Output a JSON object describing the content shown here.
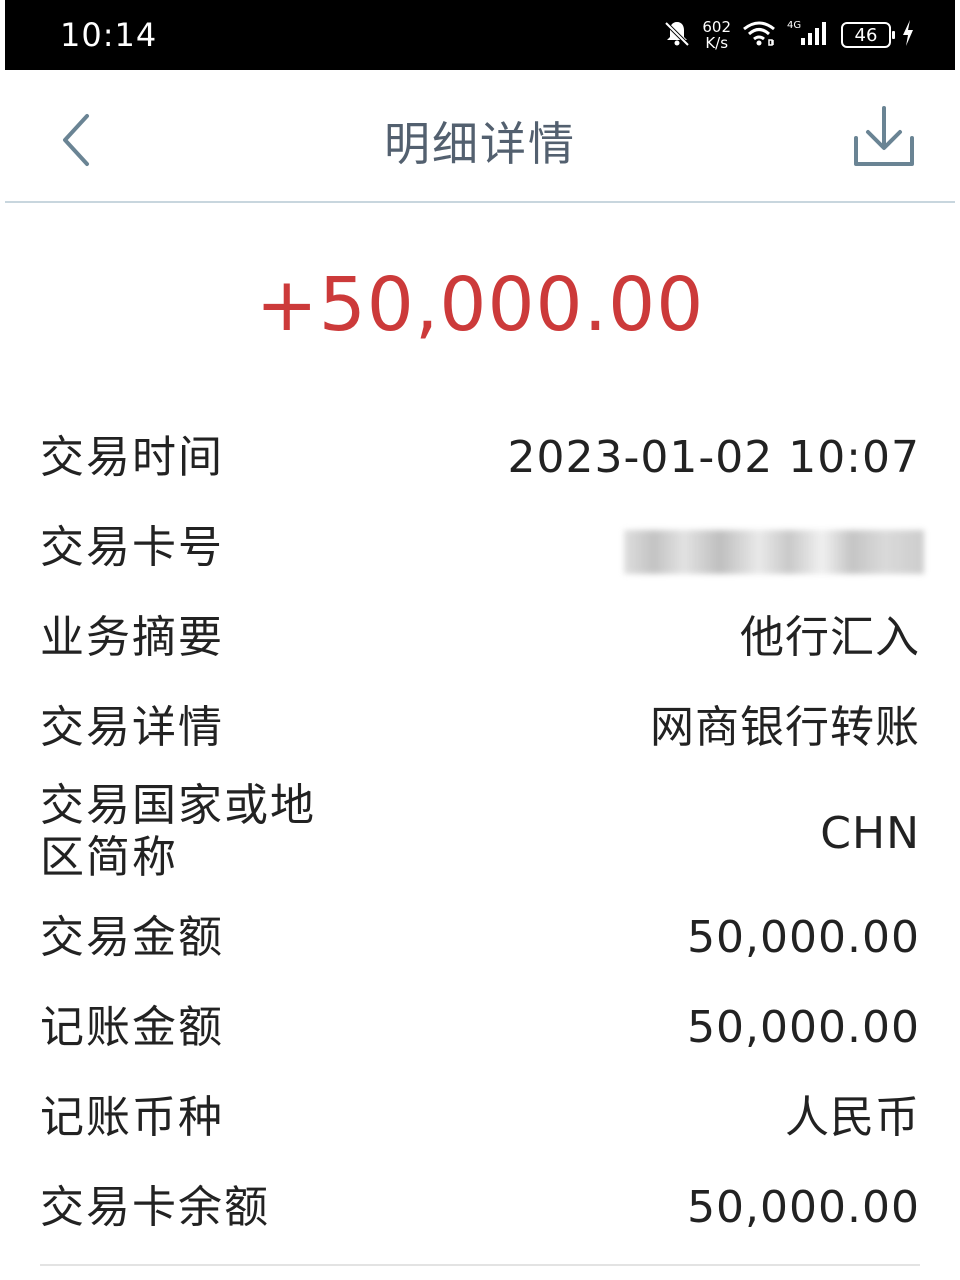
{
  "status_bar": {
    "time": "10:14",
    "net_speed_value": "602",
    "net_speed_unit": "K/s",
    "network_type": "4G",
    "battery_level": "46",
    "icons": [
      "bell-muted-icon",
      "wifi-icon",
      "cellular-signal-icon",
      "battery-icon",
      "charging-icon"
    ]
  },
  "header": {
    "title": "明细详情",
    "back_icon": "chevron-left-icon",
    "download_icon": "download-icon"
  },
  "amount": "+50,000.00",
  "colors": {
    "amount": "#cc3a3a",
    "nav_title": "#53606f",
    "nav_icons": "#6a8494",
    "divider": "#c8d6de",
    "text": "#222222"
  },
  "details": {
    "time_label": "交易时间",
    "time_value": "2023-01-02 10:07",
    "card_label": "交易卡号",
    "summary_label": "业务摘要",
    "summary_value": "他行汇入",
    "detail_label": "交易详情",
    "detail_value": "网商银行转账",
    "country_label_line1": "交易国家或地",
    "country_label_line2": "区简称",
    "country_value": "CHN",
    "txn_amount_label": "交易金额",
    "txn_amount_value": "50,000.00",
    "posted_amount_label": "记账金额",
    "posted_amount_value": "50,000.00",
    "currency_label": "记账币种",
    "currency_value": "人民币",
    "balance_label": "交易卡余额",
    "balance_value": "50,000.00"
  }
}
